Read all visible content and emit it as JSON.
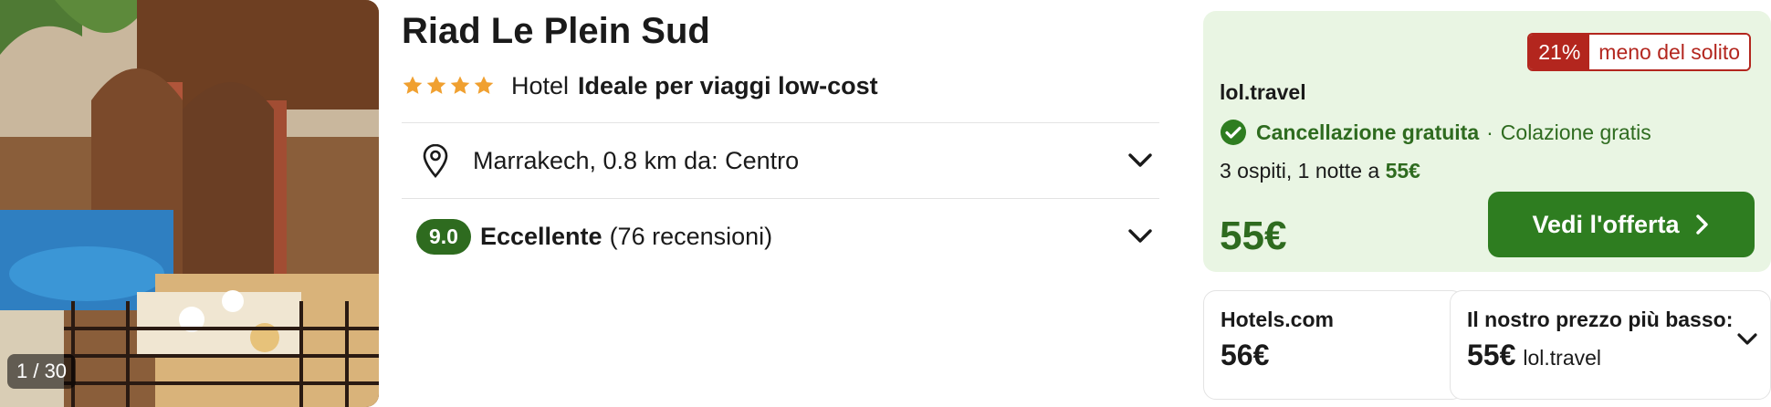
{
  "photo": {
    "counter": "1 / 30",
    "image_name": "hotel-courtyard-photo"
  },
  "hotel": {
    "name": "Riad Le Plein Sud",
    "stars": 4,
    "type": "Hotel",
    "tagline": "Ideale per viaggi low-cost",
    "location": "Marrakech, 0.8 km da: Centro",
    "rating": {
      "score": "9.0",
      "label": "Eccellente",
      "reviews": "(76 recensioni)"
    }
  },
  "offer": {
    "deal_percent": "21%",
    "deal_text": "meno del solito",
    "provider": "lol.travel",
    "cancellation": "Cancellazione gratuita",
    "separator": "·",
    "breakfast": "Colazione gratis",
    "guests_text": "3 ospiti, 1 notte a",
    "guests_price": "55€",
    "price": "55€",
    "cta_label": "Vedi l'offerta"
  },
  "other_prices": [
    {
      "provider": "Hotels.com",
      "price": "56€"
    },
    {
      "label": "Il nostro prezzo più basso:",
      "price": "55€",
      "provider": "lol.travel"
    }
  ],
  "colors": {
    "accent_green": "#2e7d20",
    "text_green": "#2e6b1f",
    "offer_background": "#e9f5e3",
    "deal_red": "#b3261e",
    "star_orange": "#f0a030"
  },
  "icons": {
    "star": "star-icon",
    "location": "map-pin-icon",
    "expand": "chevron-down-icon",
    "check": "check-circle-icon",
    "cta": "chevron-right-icon"
  }
}
